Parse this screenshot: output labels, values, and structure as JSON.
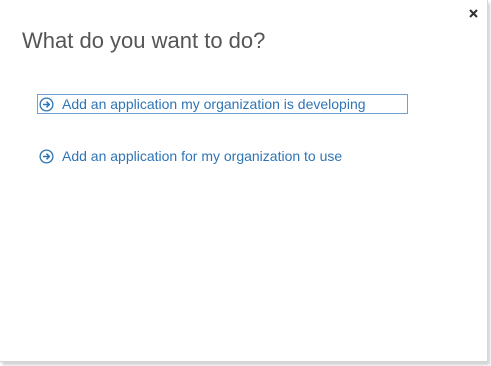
{
  "dialog": {
    "title": "What do you want to do?",
    "close_label": "×",
    "options": [
      {
        "label": "Add an application my organization is developing",
        "icon": "circle-arrow-right-icon",
        "focused": true
      },
      {
        "label": "Add an application for my organization to use",
        "icon": "circle-arrow-right-icon",
        "focused": false
      }
    ]
  },
  "colors": {
    "link": "#2e75b6",
    "title": "#555555",
    "focus_border": "#6f9fd3"
  }
}
